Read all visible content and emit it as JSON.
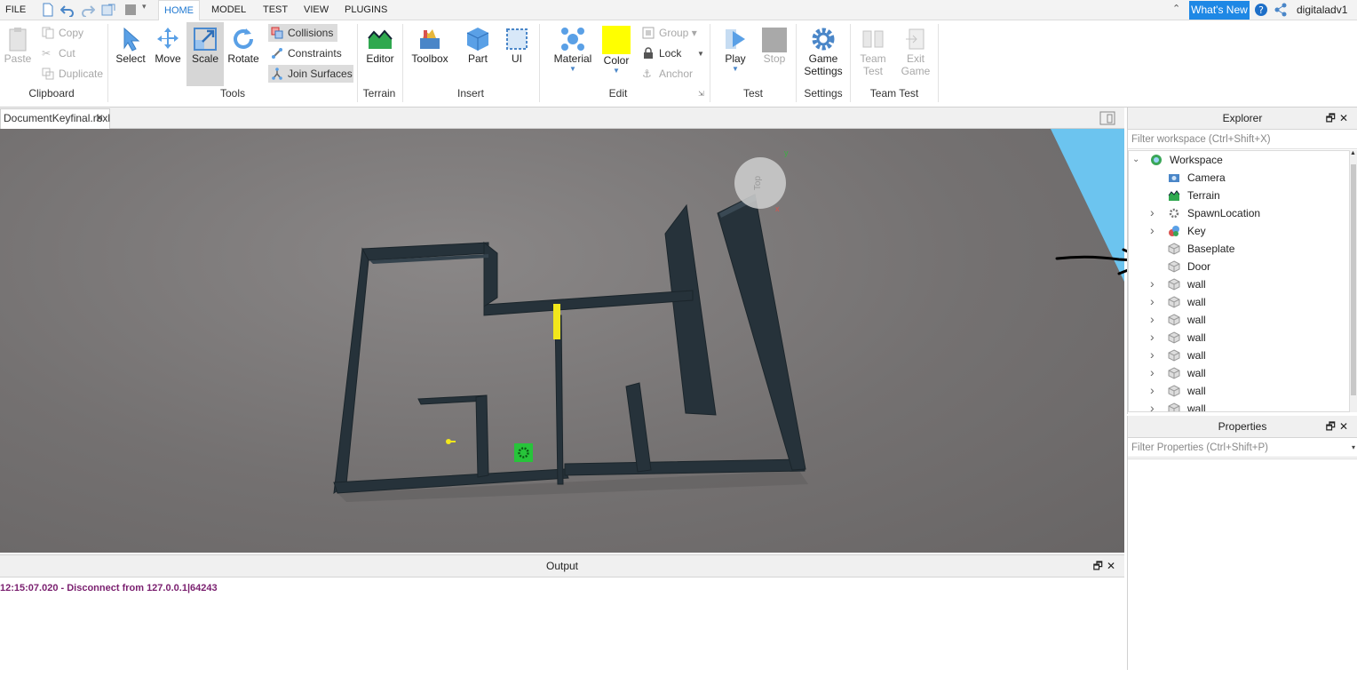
{
  "menubar": {
    "file": "FILE",
    "tabs": [
      "HOME",
      "MODEL",
      "TEST",
      "VIEW",
      "PLUGINS"
    ],
    "active_tab": "HOME",
    "whats_new": "What's New",
    "username": "digitaladv1"
  },
  "ribbon": {
    "clipboard": {
      "paste": "Paste",
      "copy": "Copy",
      "cut": "Cut",
      "duplicate": "Duplicate",
      "label": "Clipboard"
    },
    "tools": {
      "select": "Select",
      "move": "Move",
      "scale": "Scale",
      "rotate": "Rotate",
      "collisions": "Collisions",
      "constraints": "Constraints",
      "join_surfaces": "Join Surfaces",
      "label": "Tools"
    },
    "terrain": {
      "editor": "Editor",
      "label": "Terrain"
    },
    "insert": {
      "toolbox": "Toolbox",
      "part": "Part",
      "ui": "UI",
      "label": "Insert"
    },
    "edit": {
      "material": "Material",
      "color": "Color",
      "group": "Group",
      "lock": "Lock",
      "anchor": "Anchor",
      "label": "Edit",
      "color_swatch": "#ffff00"
    },
    "test": {
      "play": "Play",
      "stop": "Stop",
      "label": "Test"
    },
    "settings": {
      "game": "Game",
      "settings_word": "Settings",
      "label": "Settings"
    },
    "team_test": {
      "team": "Team",
      "test_word": "Test",
      "exit": "Exit",
      "game": "Game",
      "label": "Team Test"
    }
  },
  "document": {
    "tab": "DocumentKeyfinal.rbxl"
  },
  "viewport": {
    "view_cube_label": "Top",
    "axis_y": "y",
    "axis_x": "x"
  },
  "output": {
    "title": "Output",
    "lines": [
      "12:15:07.020 - Disconnect from 127.0.0.1|64243"
    ]
  },
  "explorer": {
    "title": "Explorer",
    "filter_placeholder": "Filter workspace (Ctrl+Shift+X)",
    "items": [
      {
        "label": "Workspace",
        "icon": "workspace-icon",
        "indent": 0,
        "expand": "open"
      },
      {
        "label": "Camera",
        "icon": "camera-icon",
        "indent": 1,
        "expand": "none"
      },
      {
        "label": "Terrain",
        "icon": "terrain-icon",
        "indent": 1,
        "expand": "none"
      },
      {
        "label": "SpawnLocation",
        "icon": "spawn-icon",
        "indent": 1,
        "expand": "closed"
      },
      {
        "label": "Key",
        "icon": "model-icon",
        "indent": 1,
        "expand": "closed"
      },
      {
        "label": "Baseplate",
        "icon": "part-icon",
        "indent": 1,
        "expand": "none"
      },
      {
        "label": "Door",
        "icon": "part-icon",
        "indent": 1,
        "expand": "none"
      },
      {
        "label": "wall",
        "icon": "part-icon",
        "indent": 1,
        "expand": "closed"
      },
      {
        "label": "wall",
        "icon": "part-icon",
        "indent": 1,
        "expand": "closed"
      },
      {
        "label": "wall",
        "icon": "part-icon",
        "indent": 1,
        "expand": "closed"
      },
      {
        "label": "wall",
        "icon": "part-icon",
        "indent": 1,
        "expand": "closed"
      },
      {
        "label": "wall",
        "icon": "part-icon",
        "indent": 1,
        "expand": "closed"
      },
      {
        "label": "wall",
        "icon": "part-icon",
        "indent": 1,
        "expand": "closed"
      },
      {
        "label": "wall",
        "icon": "part-icon",
        "indent": 1,
        "expand": "closed"
      },
      {
        "label": "wall",
        "icon": "part-icon",
        "indent": 1,
        "expand": "closed"
      }
    ]
  },
  "properties": {
    "title": "Properties",
    "filter_placeholder": "Filter Properties (Ctrl+Shift+P)"
  },
  "colors": {
    "accent": "#1e88e5",
    "output_text": "#7a1f6f",
    "wall": "#26323a"
  }
}
